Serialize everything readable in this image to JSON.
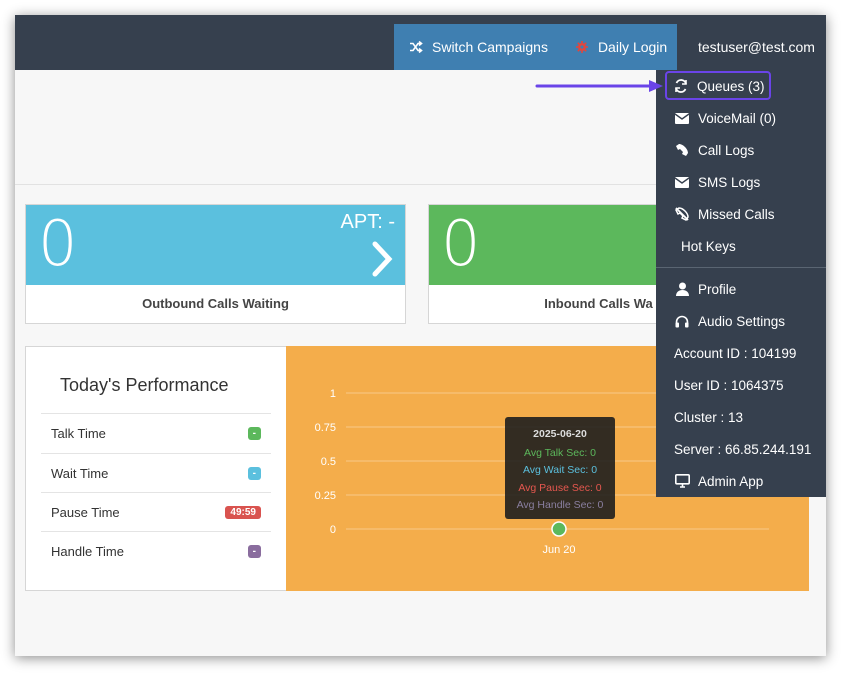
{
  "topbar": {
    "switch_campaigns": "Switch Campaigns",
    "daily_login": "Daily Login",
    "user_email": "testuser@test.com"
  },
  "cards": [
    {
      "value": "0",
      "apt": "APT: -",
      "label": "Outbound Calls Waiting",
      "color": "#5bc0de"
    },
    {
      "value": "0",
      "label": "Inbound Calls Wa",
      "color": "#5cb85c"
    }
  ],
  "performance": {
    "title": "Today's Performance",
    "rows": [
      {
        "label": "Talk Time",
        "value": "-",
        "color": "#5cb85c"
      },
      {
        "label": "Wait Time",
        "value": "-",
        "color": "#5bc0de"
      },
      {
        "label": "Pause Time",
        "value": "49:59",
        "color": "#d9534f"
      },
      {
        "label": "Handle Time",
        "value": "-",
        "color": "#8a6d9e"
      }
    ]
  },
  "chart_data": {
    "type": "line",
    "yticks": [
      "1",
      "0.75",
      "0.5",
      "0.25",
      "0"
    ],
    "ylim": [
      0,
      1
    ],
    "categories": [
      "Jun 20"
    ],
    "series": [
      {
        "name": "Avg Talk Sec",
        "values": [
          0
        ],
        "color": "#5cb85c"
      },
      {
        "name": "Avg Wait Sec",
        "values": [
          0
        ],
        "color": "#5bc0de"
      },
      {
        "name": "Avg Pause Sec",
        "values": [
          0
        ],
        "color": "#d9534f"
      },
      {
        "name": "Avg Handle Sec",
        "values": [
          0
        ],
        "color": "#8a7fa0"
      }
    ],
    "tooltip": {
      "title": "2025-06-20",
      "lines": [
        "Avg Talk Sec: 0",
        "Avg Wait Sec: 0",
        "Avg Pause Sec: 0",
        "Avg Handle Sec: 0"
      ]
    }
  },
  "dropdown": {
    "items": [
      {
        "label": "Queues (3)",
        "icon": "refresh-icon"
      },
      {
        "label": "VoiceMail (0)",
        "icon": "envelope-icon"
      },
      {
        "label": "Call Logs",
        "icon": "phone-icon"
      },
      {
        "label": "SMS Logs",
        "icon": "envelope-icon"
      },
      {
        "label": "Missed Calls",
        "icon": "missed-call-icon"
      },
      {
        "label": "Hot Keys",
        "icon": ""
      },
      {
        "label": "Profile",
        "icon": "user-icon"
      },
      {
        "label": "Audio Settings",
        "icon": "headphones-icon"
      },
      {
        "label": "Account ID : 104199",
        "icon": ""
      },
      {
        "label": "User ID : 1064375",
        "icon": ""
      },
      {
        "label": "Cluster : 13",
        "icon": ""
      },
      {
        "label": "Server : 66.85.244.191",
        "icon": ""
      },
      {
        "label": "Admin App",
        "icon": "monitor-icon"
      }
    ]
  },
  "colors": {
    "topbar": "#36404e",
    "active_nav": "#3f7fb1",
    "chart_bg": "#f4ad4b",
    "highlight": "#6a44e8"
  }
}
